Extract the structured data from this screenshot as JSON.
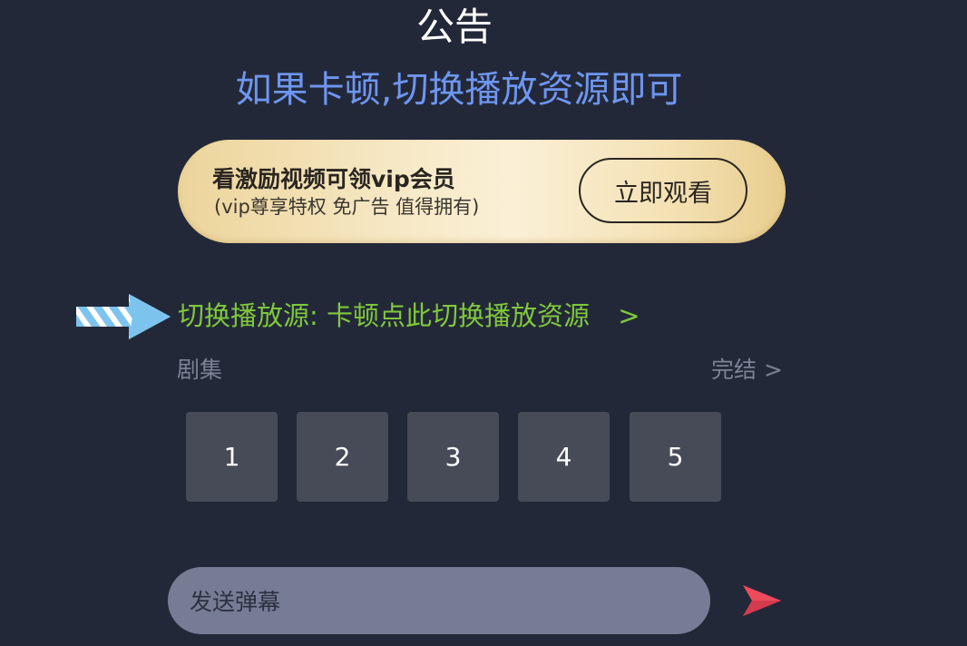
{
  "notice": {
    "title": "公告",
    "message": "如果卡顿,切换播放资源即可"
  },
  "vip_banner": {
    "title": "看激励视频可领vip会员",
    "subtitle": "(vip尊享特权 免广告 值得拥有)",
    "button_label": "立即观看"
  },
  "switch_source": {
    "label": "切换播放源:",
    "text": "卡顿点此切换播放资源",
    "chevron": ">"
  },
  "episodes": {
    "label": "剧集",
    "status": "完结 >",
    "items": [
      {
        "label": "1"
      },
      {
        "label": "2"
      },
      {
        "label": "3"
      },
      {
        "label": "4"
      },
      {
        "label": "5"
      }
    ]
  },
  "danmaku": {
    "placeholder": "发送弹幕",
    "send_icon": "send-icon"
  },
  "icons": {
    "pointer": "arrow-right-icon",
    "send": "send-icon"
  },
  "colors": {
    "background": "#232839",
    "notice_message": "#6e96f0",
    "switch_source": "#7fc93a",
    "episode_tile": "#464b57",
    "input_bg": "#777c95",
    "send_accent": "#ef4a5c",
    "arrow_blue": "#7cc4ee"
  }
}
